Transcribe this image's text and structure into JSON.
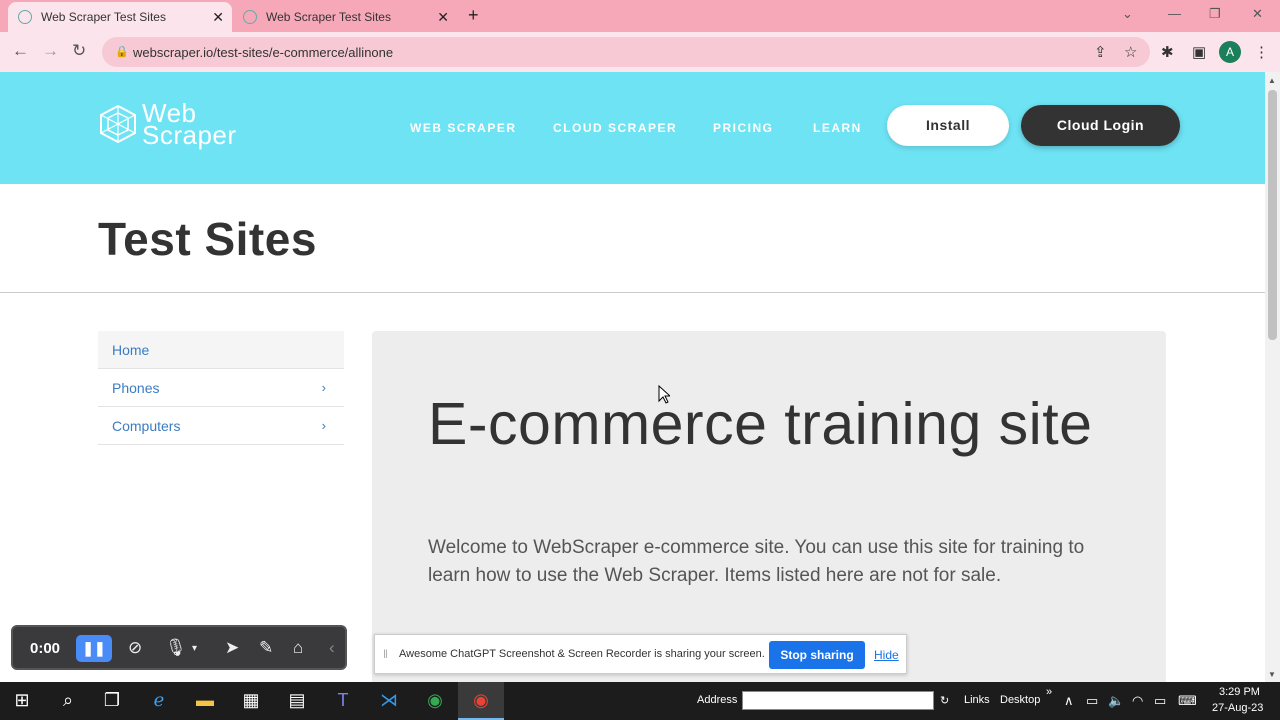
{
  "browser": {
    "tabs": [
      {
        "title": "Web Scraper Test Sites",
        "active": true
      },
      {
        "title": "Web Scraper Test Sites",
        "active": false
      }
    ],
    "new_tab": "+",
    "url": "webscraper.io/test-sites/e-commerce/allinone",
    "profile_initial": "A"
  },
  "site": {
    "logo_line1": "Web",
    "logo_line2": "Scraper",
    "nav": [
      "WEB SCRAPER",
      "CLOUD SCRAPER",
      "PRICING",
      "LEARN"
    ],
    "install_label": "Install",
    "cloud_login_label": "Cloud Login",
    "page_title": "Test Sites",
    "sidebar": [
      "Home",
      "Phones",
      "Computers"
    ],
    "jumbotron_title": "E-commerce training site",
    "jumbotron_text": "Welcome to WebScraper e-commerce site. You can use this site for training to learn how to use the Web Scraper. Items listed here are not for sale."
  },
  "recorder": {
    "time": "0:00"
  },
  "sharebar": {
    "message": "Awesome ChatGPT Screenshot & Screen Recorder is sharing your screen.",
    "stop_label": "Stop sharing",
    "hide_label": "Hide"
  },
  "taskbar": {
    "address_label": "Address",
    "links_label": "Links",
    "desktop_label": "Desktop",
    "time": "3:29 PM",
    "date": "27-Aug-23"
  },
  "colors": {
    "tabstrip": "#f7a8b8",
    "toolbar": "#fce4ec",
    "hero": "#6ee3f4",
    "link": "#3b7cc0",
    "stop_button": "#1a73e8"
  }
}
